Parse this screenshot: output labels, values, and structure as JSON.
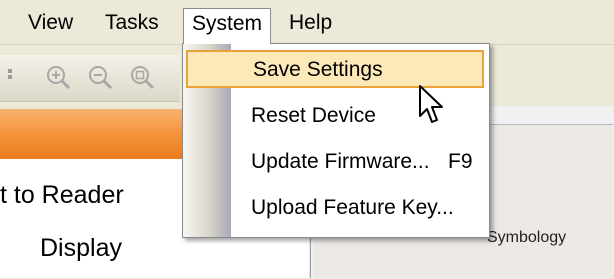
{
  "menubar": {
    "items": [
      {
        "label": "View"
      },
      {
        "label": "Tasks"
      },
      {
        "label": "System"
      },
      {
        "label": "Help"
      }
    ]
  },
  "toolbar": {
    "icons": [
      "zoom-in-icon",
      "zoom-out-icon",
      "zoom-fit-icon"
    ]
  },
  "left_pane": {
    "row1": "t to Reader",
    "row2": "Display"
  },
  "right_pane": {
    "label": "Symbology"
  },
  "system_menu": {
    "items": [
      {
        "label": "Save Settings",
        "shortcut": "",
        "highlighted": true
      },
      {
        "label": "Reset Device",
        "shortcut": ""
      },
      {
        "label": "Update Firmware...",
        "shortcut": "F9"
      },
      {
        "label": "Upload Feature Key...",
        "shortcut": ""
      }
    ]
  },
  "colors": {
    "highlight_fill": "#fde9b8",
    "highlight_border": "#e9a23a",
    "accent_orange": "#f39137"
  }
}
